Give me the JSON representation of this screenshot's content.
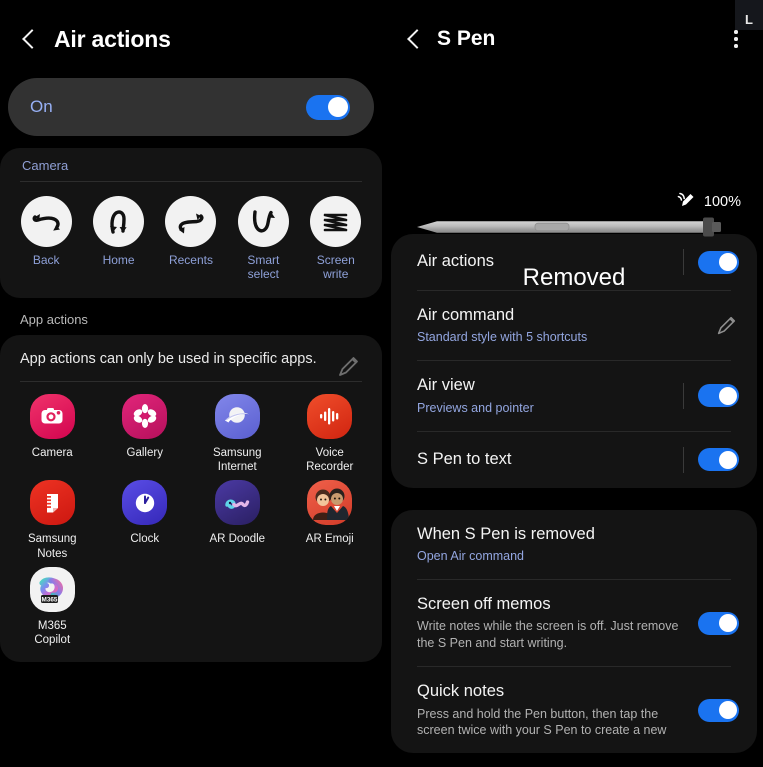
{
  "left_panel": {
    "header": {
      "back_icon": "chevron-left-icon",
      "title": "Air actions"
    },
    "master_toggle": {
      "label": "On",
      "state": "on"
    },
    "camera_section": {
      "heading": "Camera",
      "gestures": [
        {
          "label": "Back",
          "icon": "gesture-back-arrow-icon"
        },
        {
          "label": "Home",
          "icon": "gesture-home-arrow-icon"
        },
        {
          "label": "Recents",
          "icon": "gesture-recents-arrow-icon"
        },
        {
          "label": "Smart\nselect",
          "label_line1": "Smart",
          "label_line2": "select",
          "icon": "gesture-smart-select-arrow-icon"
        },
        {
          "label": "Screen\nwrite",
          "label_line1": "Screen",
          "label_line2": "write",
          "icon": "gesture-screen-write-zigzag-icon"
        }
      ]
    },
    "app_actions": {
      "heading": "App actions",
      "description": "App actions can only be used in specific apps.",
      "edit_icon": "pencil-icon",
      "apps": [
        {
          "label_line1": "Camera",
          "label_line2": "",
          "icon": "camera-app-icon",
          "color": "#e0215c"
        },
        {
          "label_line1": "Gallery",
          "label_line2": "",
          "icon": "gallery-app-icon",
          "color": "#d61a6e"
        },
        {
          "label_line1": "Samsung",
          "label_line2": "Internet",
          "icon": "samsung-internet-app-icon",
          "color": "#6b6fe0"
        },
        {
          "label_line1": "Voice",
          "label_line2": "Recorder",
          "icon": "voice-recorder-app-icon",
          "color": "#e23a22"
        },
        {
          "label_line1": "Samsung",
          "label_line2": "Notes",
          "icon": "samsung-notes-app-icon",
          "color": "#e0231c"
        },
        {
          "label_line1": "Clock",
          "label_line2": "",
          "icon": "clock-app-icon",
          "color": "#4439cf"
        },
        {
          "label_line1": "AR Doodle",
          "label_line2": "",
          "icon": "ar-doodle-app-icon",
          "color": "#3a2b86"
        },
        {
          "label_line1": "AR Emoji",
          "label_line2": "",
          "icon": "ar-emoji-app-icon",
          "color": "#e0503f"
        },
        {
          "label_line1": "M365",
          "label_line2": "Copilot",
          "icon": "m365-copilot-app-icon",
          "color": "#f2f2f2",
          "badge": "M365"
        }
      ]
    }
  },
  "right_panel": {
    "header": {
      "back_icon": "chevron-left-icon",
      "title": "S Pen",
      "menu_icon": "more-vertical-icon"
    },
    "pen_status": {
      "battery_icon": "spen-battery-icon",
      "battery_level": "100%",
      "pen_illustration": "s-pen-image",
      "status_text": "Removed"
    },
    "settings_group_1": [
      {
        "title": "Air actions",
        "subtitle": "",
        "control": "toggle",
        "state": "on"
      },
      {
        "title": "Air command",
        "subtitle": "Standard style with 5 shortcuts",
        "control": "pencil",
        "state": ""
      },
      {
        "title": "Air view",
        "subtitle": "Previews and pointer",
        "control": "toggle",
        "state": "on"
      },
      {
        "title": "S Pen to text",
        "subtitle": "",
        "control": "toggle",
        "state": "on"
      }
    ],
    "settings_group_2": [
      {
        "title": "When S Pen is removed",
        "subtitle": "Open Air command",
        "control": "none",
        "state": ""
      },
      {
        "title": "Screen off memos",
        "subtitle": "Write notes while the screen is off. Just remove the S Pen and start writing.",
        "control": "toggle",
        "state": "on",
        "subtitle_grey": true
      },
      {
        "title": "Quick notes",
        "subtitle": "Press and hold the Pen button, then tap the screen twice with your S Pen to create a new",
        "control": "toggle",
        "state": "on",
        "subtitle_grey": true
      }
    ]
  },
  "corner_badge": {
    "text": "L"
  },
  "colors": {
    "accent_blue": "#1a73f0",
    "link_blue": "#93a6e0",
    "card_bg": "#141414",
    "page_bg": "#000000"
  }
}
